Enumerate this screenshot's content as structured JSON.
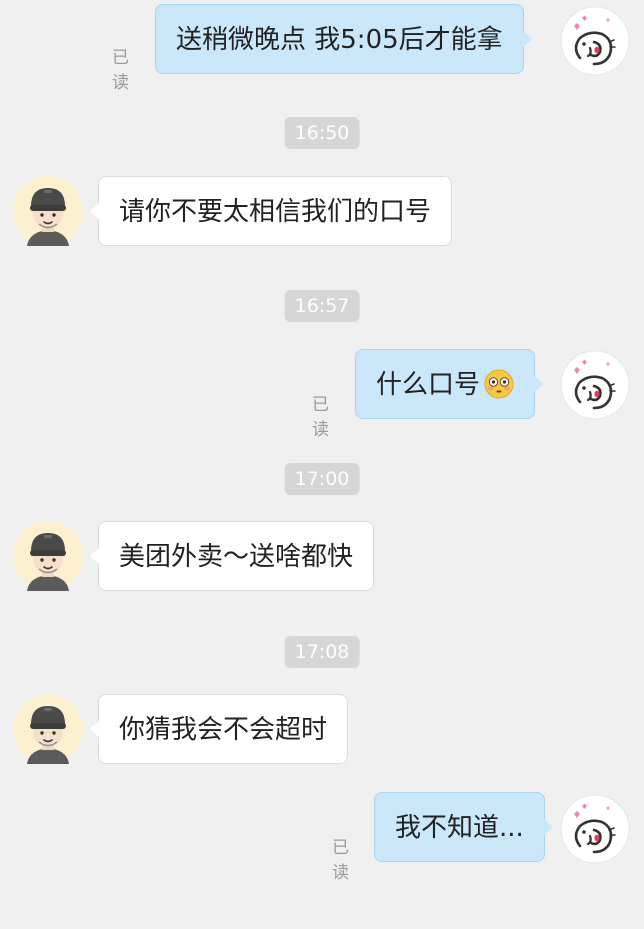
{
  "messages": [
    {
      "kind": "out",
      "text": "送稍微晚点 我5:05后才能拿",
      "status": "已读"
    },
    {
      "kind": "time",
      "text": "16:50"
    },
    {
      "kind": "in",
      "text": "请你不要太相信我们的口号"
    },
    {
      "kind": "time",
      "text": "16:57"
    },
    {
      "kind": "out",
      "text": "什么口号",
      "emoji": "flushed-face-emoji",
      "status": "已读"
    },
    {
      "kind": "time",
      "text": "17:00"
    },
    {
      "kind": "in",
      "text": "美团外卖～送啥都快"
    },
    {
      "kind": "time",
      "text": "17:08"
    },
    {
      "kind": "in",
      "text": "你猜我会不会超时"
    },
    {
      "kind": "out",
      "text": "我不知道...",
      "status": "已读"
    }
  ],
  "icons": {
    "self_avatar": "doodle-face-avatar-with-hearts",
    "courier_avatar": "courier-with-helmet-avatar"
  },
  "colors": {
    "background": "#f0f0f0",
    "outgoing_bubble": "#cbe8fb",
    "incoming_bubble": "#ffffff",
    "timestamp_bg": "#d6d6d6",
    "read_text": "#9a9a9a"
  }
}
